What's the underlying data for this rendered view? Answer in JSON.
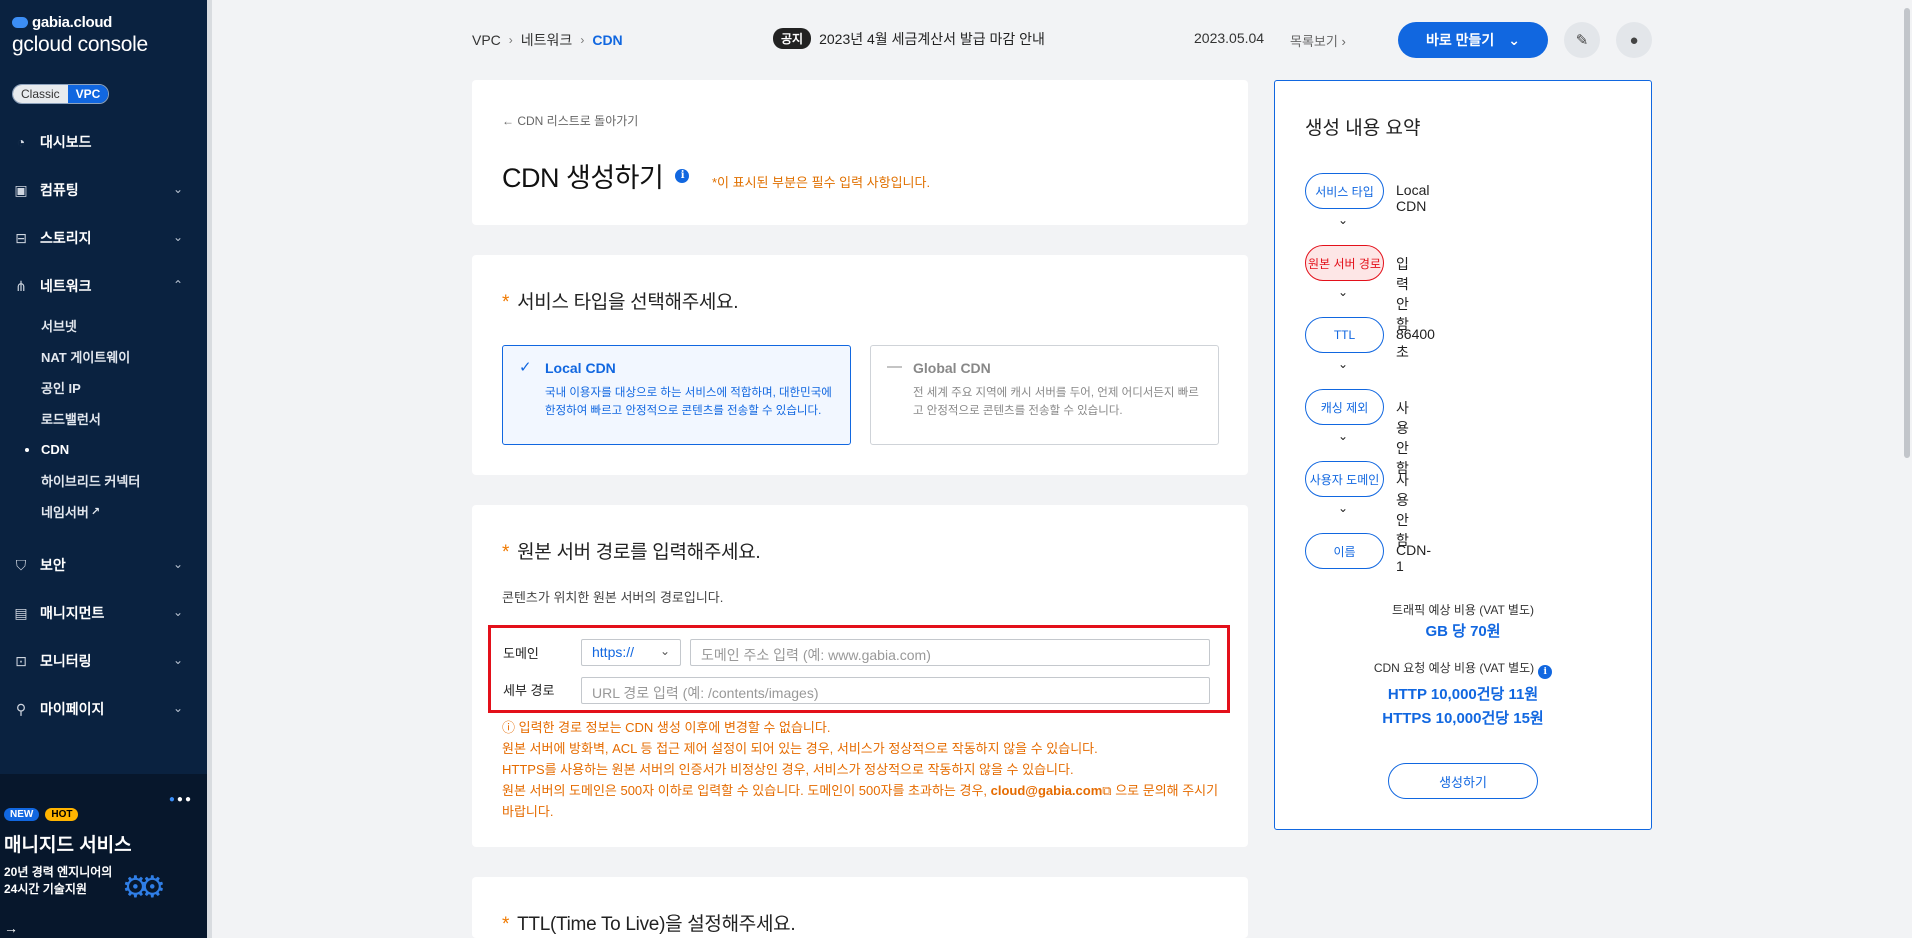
{
  "sidebar": {
    "brand_top": "gabia.cloud",
    "brand_bottom": "gcloud console",
    "mode_classic": "Classic",
    "mode_vpc": "VPC",
    "menu": [
      {
        "label": "대시보드"
      },
      {
        "label": "컴퓨팅"
      },
      {
        "label": "스토리지"
      },
      {
        "label": "네트워크"
      }
    ],
    "network_sub": [
      "서브넷",
      "NAT 게이트웨이",
      "공인 IP",
      "로드밸런서",
      "CDN",
      "하이브리드 커넥터",
      "네임서버"
    ],
    "menu_bottom": [
      {
        "label": "보안"
      },
      {
        "label": "매니지먼트"
      },
      {
        "label": "모니터링"
      },
      {
        "label": "마이페이지"
      }
    ],
    "promo": {
      "badge_new": "NEW",
      "badge_hot": "HOT",
      "title": "매니지드 서비스",
      "line1": "20년 경력 엔지니어의",
      "line2": "24시간 기술지원"
    }
  },
  "topbar": {
    "breadcrumb": [
      "VPC",
      "네트워크",
      "CDN"
    ],
    "notice_tag": "공지",
    "notice_text": "2023년 4월 세금계산서 발급 마감 안내",
    "notice_date": "2023.05.04",
    "notice_list": "목록보기",
    "create_button": "바로 만들기"
  },
  "header_card": {
    "back_link": "CDN 리스트로 돌아가기",
    "title": "CDN 생성하기",
    "required_note": "*이 표시된 부분은 필수 입력 사항입니다."
  },
  "service_type": {
    "title": "서비스 타입을 선택해주세요.",
    "options": [
      {
        "title": "Local CDN",
        "desc": "국내 이용자를 대상으로 하는 서비스에 적합하며, 대한민국에 한정하여 빠르고 안정적으로 콘텐츠를 전송할 수 있습니다."
      },
      {
        "title": "Global CDN",
        "desc": "전 세계 주요 지역에 캐시 서버를 두어, 언제 어디서든지 빠르고 안정적으로 콘텐츠를 전송할 수 있습니다."
      }
    ]
  },
  "origin": {
    "title": "원본 서버 경로를 입력해주세요.",
    "desc": "콘텐츠가 위치한 원본 서버의 경로입니다.",
    "domain_label": "도메인",
    "protocol": "https://",
    "domain_placeholder": "도메인 주소 입력 (예: www.gabia.com)",
    "path_label": "세부 경로",
    "path_placeholder": "URL 경로 입력 (예: /contents/images)",
    "warn1": "입력한 경로 정보는 CDN 생성 이후에 변경할 수 없습니다.",
    "warn2": "원본 서버에 방화벽, ACL 등 접근 제어 설정이 되어 있는 경우, 서비스가 정상적으로 작동하지 않을 수 있습니다.",
    "warn3": "HTTPS를 사용하는 원본 서버의 인증서가 비정상인 경우, 서비스가 정상적으로 작동하지 않을 수 있습니다.",
    "warn4_a": "원본 서버의 도메인은 500자 이하로 입력할 수 있습니다. 도메인이 500자를 초과하는 경우,",
    "warn4_email": "cloud@gabia.com",
    "warn4_b": "으로 문의해 주시기 바랍니다."
  },
  "ttl": {
    "title": "TTL(Time To Live)을 설정해주세요."
  },
  "summary": {
    "title": "생성 내용 요약",
    "steps": [
      {
        "label": "서비스 타입",
        "value": "Local CDN"
      },
      {
        "label": "원본 서버 경로",
        "value": "입력 안 함"
      },
      {
        "label": "TTL",
        "value": "86400초"
      },
      {
        "label": "캐싱 제외",
        "value": "사용 안 함"
      },
      {
        "label": "사용자 도메인",
        "value": "사용 안 함"
      },
      {
        "label": "이름",
        "value": "CDN-1"
      }
    ],
    "traffic_label": "트래픽 예상 비용 (VAT 별도)",
    "traffic_value": "GB 당 70원",
    "request_label": "CDN 요청 예상 비용 (VAT 별도)",
    "request_http": "HTTP 10,000건당 11원",
    "request_https": "HTTPS 10,000건당 15원",
    "create_label": "생성하기"
  },
  "colors": {
    "accent": "#1167e0",
    "sidebar_bg": "#0a2240",
    "warning": "#e56b00",
    "error": "#e3101a"
  }
}
